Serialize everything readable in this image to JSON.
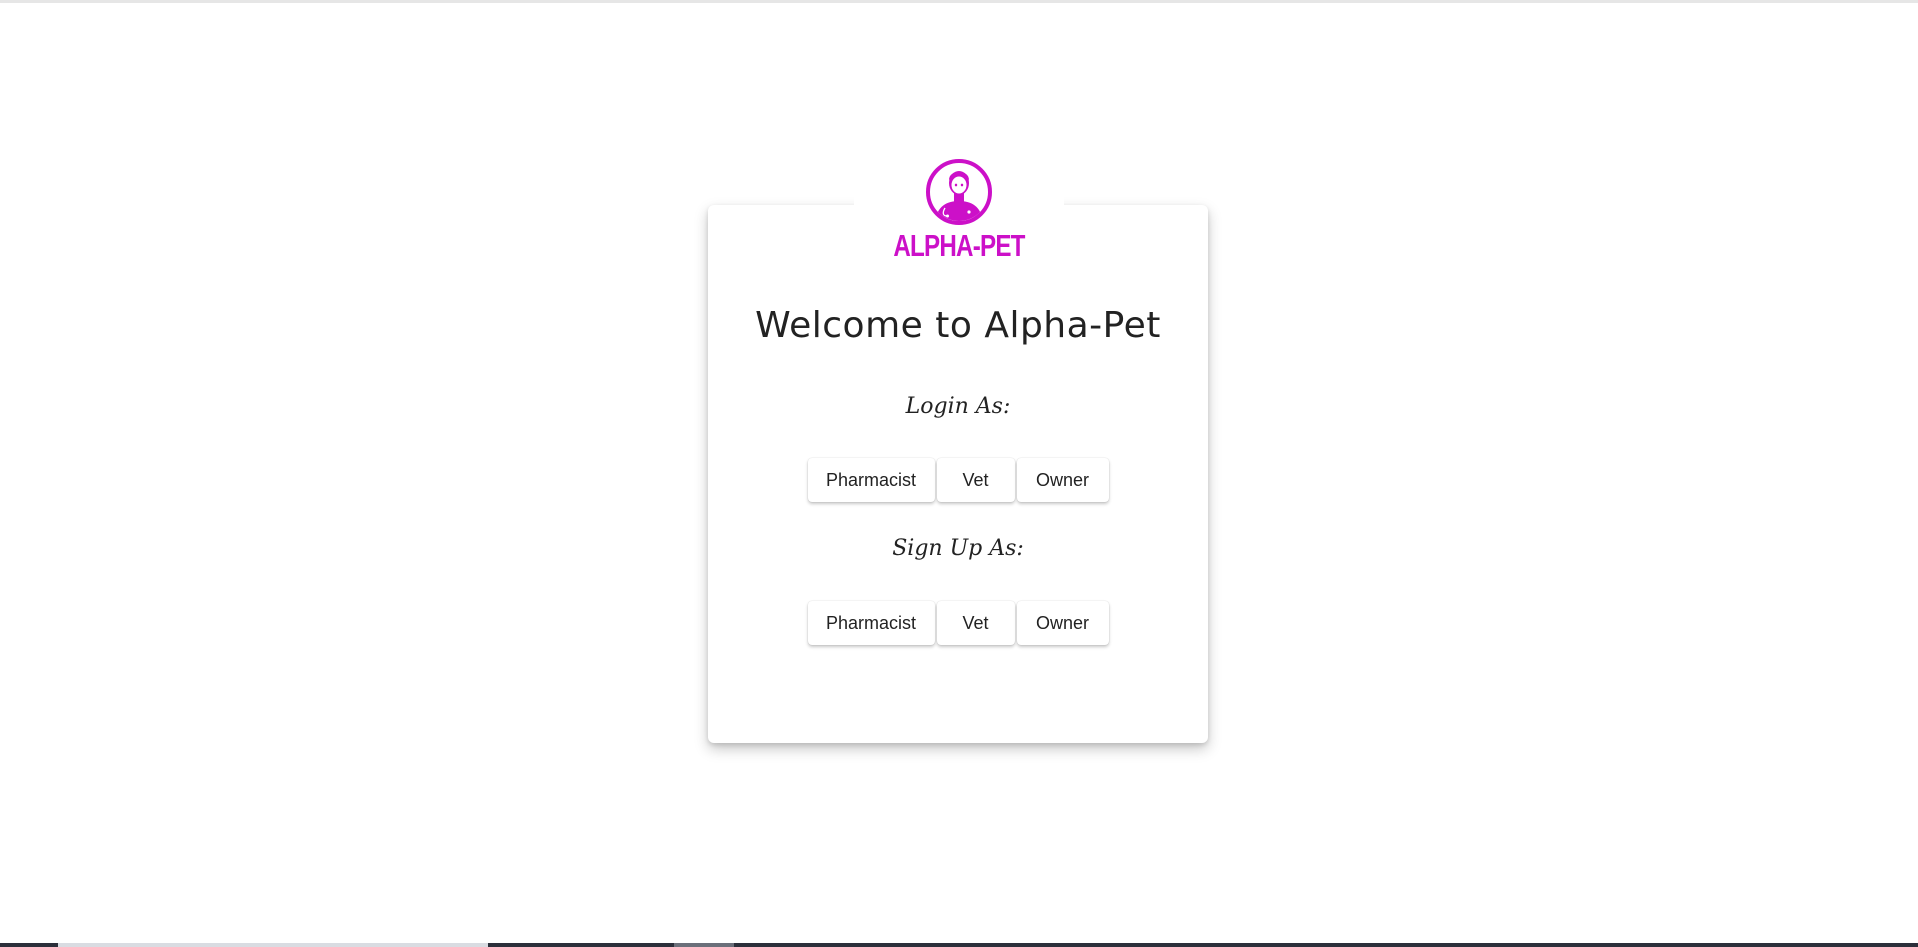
{
  "brand": {
    "name": "ALPHA-PET",
    "logo_icon": "vet-avatar-icon",
    "color": "#cc10c8"
  },
  "heading": "Welcome to Alpha-Pet",
  "login": {
    "label": "Login As:",
    "buttons": [
      "Pharmacist",
      "Vet",
      "Owner"
    ]
  },
  "signup": {
    "label": "Sign Up As:",
    "buttons": [
      "Pharmacist",
      "Vet",
      "Owner"
    ]
  }
}
